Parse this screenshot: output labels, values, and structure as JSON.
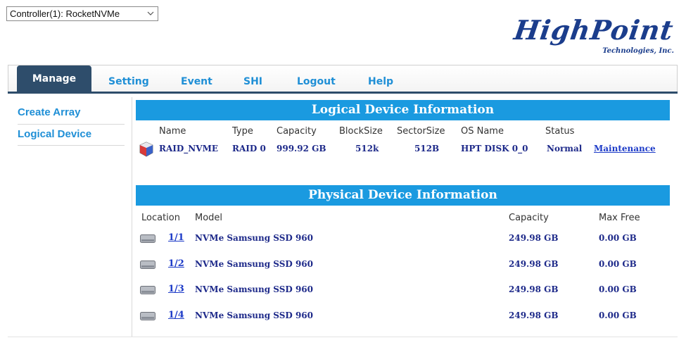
{
  "controller_select": {
    "value": "Controller(1): RocketNVMe"
  },
  "logo": {
    "main": "HighPoint",
    "sub": "Technologies, Inc."
  },
  "nav": {
    "tabs": [
      {
        "label": "Manage",
        "active": true
      },
      {
        "label": "Setting"
      },
      {
        "label": "Event"
      },
      {
        "label": "SHI"
      },
      {
        "label": "Logout"
      },
      {
        "label": "Help"
      }
    ]
  },
  "sidebar": {
    "items": [
      {
        "label": "Create Array"
      },
      {
        "label": "Logical Device"
      }
    ]
  },
  "logical": {
    "title": "Logical Device Information",
    "headers": {
      "name": "Name",
      "type": "Type",
      "capacity": "Capacity",
      "blocksize": "BlockSize",
      "sectorsize": "SectorSize",
      "osname": "OS Name",
      "status": "Status"
    },
    "row": {
      "name": "RAID_NVME",
      "type": "RAID 0",
      "capacity": "999.92 GB",
      "blocksize": "512k",
      "sectorsize": "512B",
      "osname": "HPT DISK 0_0",
      "status": "Normal",
      "action": "Maintenance"
    }
  },
  "physical": {
    "title": "Physical Device Information",
    "headers": {
      "location": "Location",
      "model": "Model",
      "capacity": "Capacity",
      "maxfree": "Max Free"
    },
    "rows": [
      {
        "location": "1/1",
        "model": "NVMe Samsung SSD 960",
        "capacity": "249.98 GB",
        "maxfree": "0.00 GB"
      },
      {
        "location": "1/2",
        "model": "NVMe Samsung SSD 960",
        "capacity": "249.98 GB",
        "maxfree": "0.00 GB"
      },
      {
        "location": "1/3",
        "model": "NVMe Samsung SSD 960",
        "capacity": "249.98 GB",
        "maxfree": "0.00 GB"
      },
      {
        "location": "1/4",
        "model": "NVMe Samsung SSD 960",
        "capacity": "249.98 GB",
        "maxfree": "0.00 GB"
      }
    ]
  },
  "colors": {
    "accent": "#1a9ae0",
    "nav_active": "#2e4d6b",
    "link": "#1f8fd6",
    "value_text": "#1e2a8a"
  }
}
